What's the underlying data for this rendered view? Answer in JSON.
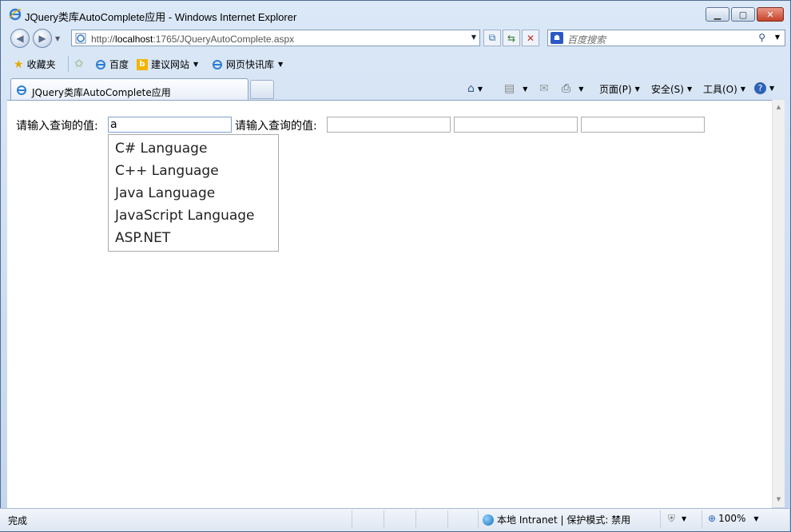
{
  "window": {
    "title": "JQuery类库AutoComplete应用 - Windows Internet Explorer"
  },
  "nav": {
    "url_prefix": "http://",
    "url_host": "localhost",
    "url_rest": ":1765/JQueryAutoComplete.aspx",
    "search_placeholder": "百度搜索"
  },
  "favorites": {
    "favorites_label": "收藏夹",
    "items": [
      "百度",
      "建议网站",
      "网页快讯库"
    ]
  },
  "tab": {
    "title": "JQuery类库AutoComplete应用"
  },
  "commands": {
    "page": "页面(P)",
    "safety": "安全(S)",
    "tools": "工具(O)"
  },
  "form": {
    "label1": "请输入查询的值:",
    "value1": "a",
    "label2": "请输入查询的值:",
    "value2": "",
    "value3": "",
    "value4": ""
  },
  "autocomplete": {
    "items": [
      "C# Language",
      "C++ Language",
      "Java Language",
      "JavaScript Language",
      "ASP.NET"
    ]
  },
  "status": {
    "text": "完成",
    "zone": "本地 Intranet | 保护模式: 禁用",
    "zoom": "100%"
  }
}
